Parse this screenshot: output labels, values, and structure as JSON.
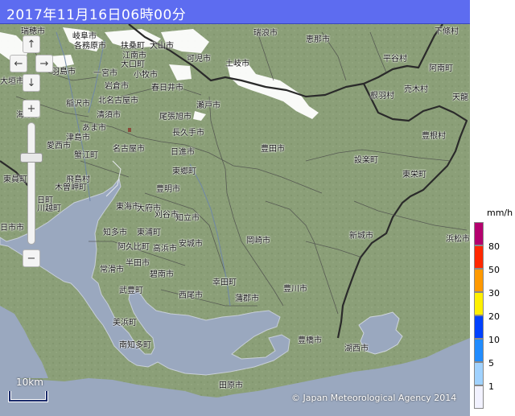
{
  "title": "2017年11月16日06時00分",
  "copyright": "© Japan Meteorological Agency 2014",
  "scale_label": "10km",
  "nav": {
    "up": "↑",
    "left": "←",
    "right": "→",
    "down": "↓",
    "zoom_in": "+",
    "zoom_out": "−"
  },
  "legend": {
    "unit": "mm/h",
    "levels": [
      {
        "label": "80",
        "color": "#b4006e"
      },
      {
        "label": "50",
        "color": "#ff2800"
      },
      {
        "label": "30",
        "color": "#ff9900"
      },
      {
        "label": "20",
        "color": "#fff000"
      },
      {
        "label": "10",
        "color": "#0041ff"
      },
      {
        "label": "5",
        "color": "#218cff"
      },
      {
        "label": "1",
        "color": "#a0d2ff"
      },
      {
        "label": "",
        "color": "#f2f2ff"
      }
    ]
  },
  "colors": {
    "land": "#8b9f78",
    "sea": "#9aa8bf",
    "title_bar": "#5d6cf0",
    "snow": "#ffffff"
  },
  "places": [
    {
      "name": "瑞穂市"
    },
    {
      "name": "岐阜市"
    },
    {
      "name": "各務原市"
    },
    {
      "name": "扶桑町"
    },
    {
      "name": "犬山市"
    },
    {
      "name": "可児市"
    },
    {
      "name": "瑞浪市"
    },
    {
      "name": "恵那市"
    },
    {
      "name": "下條村"
    },
    {
      "name": "羽島市"
    },
    {
      "name": "江南市"
    },
    {
      "name": "岩倉市"
    },
    {
      "name": "大口町"
    },
    {
      "name": "多治見市"
    },
    {
      "name": "土岐市"
    },
    {
      "name": "平谷村"
    },
    {
      "name": "阿南町"
    },
    {
      "name": "一宮市"
    },
    {
      "name": "小牧市"
    },
    {
      "name": "大垣市"
    },
    {
      "name": "稲沢市"
    },
    {
      "name": "北名古屋市"
    },
    {
      "name": "春日井市"
    },
    {
      "name": "根羽村"
    },
    {
      "name": "売木村"
    },
    {
      "name": "天龍"
    },
    {
      "name": "海津市"
    },
    {
      "name": "清須市"
    },
    {
      "name": "尾張旭市"
    },
    {
      "name": "瀬戸市"
    },
    {
      "name": "あま市"
    },
    {
      "name": "長久手市"
    },
    {
      "name": "愛西市"
    },
    {
      "name": "名古屋市"
    },
    {
      "name": "日進市"
    },
    {
      "name": "豊根村"
    },
    {
      "name": "津島市"
    },
    {
      "name": "蟹江町"
    },
    {
      "name": "豊田市"
    },
    {
      "name": "設楽町"
    },
    {
      "name": "東郷町"
    },
    {
      "name": "東栄町"
    },
    {
      "name": "東員町"
    },
    {
      "name": "飛島村"
    },
    {
      "name": "木曽岬町"
    },
    {
      "name": "豊明市"
    },
    {
      "name": "日町"
    },
    {
      "name": "川越町"
    },
    {
      "name": "東海市"
    },
    {
      "name": "大府市"
    },
    {
      "name": "刈谷市"
    },
    {
      "name": "知立市"
    },
    {
      "name": "日市市"
    },
    {
      "name": "知多市"
    },
    {
      "name": "東浦町"
    },
    {
      "name": "岡崎市"
    },
    {
      "name": "新城市"
    },
    {
      "name": "浜松市"
    },
    {
      "name": "阿久比町"
    },
    {
      "name": "高浜市"
    },
    {
      "name": "安城市"
    },
    {
      "name": "常滑市"
    },
    {
      "name": "半田市"
    },
    {
      "name": "碧南市"
    },
    {
      "name": "幸田町"
    },
    {
      "name": "西尾市"
    },
    {
      "name": "武豊町"
    },
    {
      "name": "豊川市"
    },
    {
      "name": "蒲郡市"
    },
    {
      "name": "美浜町"
    },
    {
      "name": "南知多町"
    },
    {
      "name": "豊橋市"
    },
    {
      "name": "湖西市"
    },
    {
      "name": "田原市"
    }
  ]
}
